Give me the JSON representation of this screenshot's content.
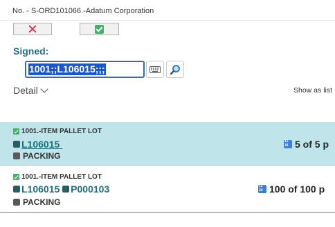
{
  "header": {
    "title": "No. - S-ORD101066.-Adatum Corporation"
  },
  "actions": {
    "cancel_icon": "close-icon",
    "confirm_icon": "check-icon"
  },
  "signed": {
    "label": "Signed:",
    "value": "1001;;L106015;;;"
  },
  "detail": {
    "label": "Detail",
    "show_as_list": "Show as list"
  },
  "rows": [
    {
      "item": "1001.-ITEM PALLET LOT",
      "lot": "L106015",
      "pallet": "",
      "location": "PACKING",
      "quantity": "5 of 5 p",
      "selected": true
    },
    {
      "item": "1001.-ITEM PALLET LOT",
      "lot": "L106015",
      "pallet": "P000103",
      "location": "PACKING",
      "quantity": "100 of 100 p",
      "selected": false
    }
  ],
  "colors": {
    "accent": "#1f7180",
    "selected_row": "#bfe5ea",
    "cancel": "#d93b5a",
    "confirm": "#47b06b"
  }
}
